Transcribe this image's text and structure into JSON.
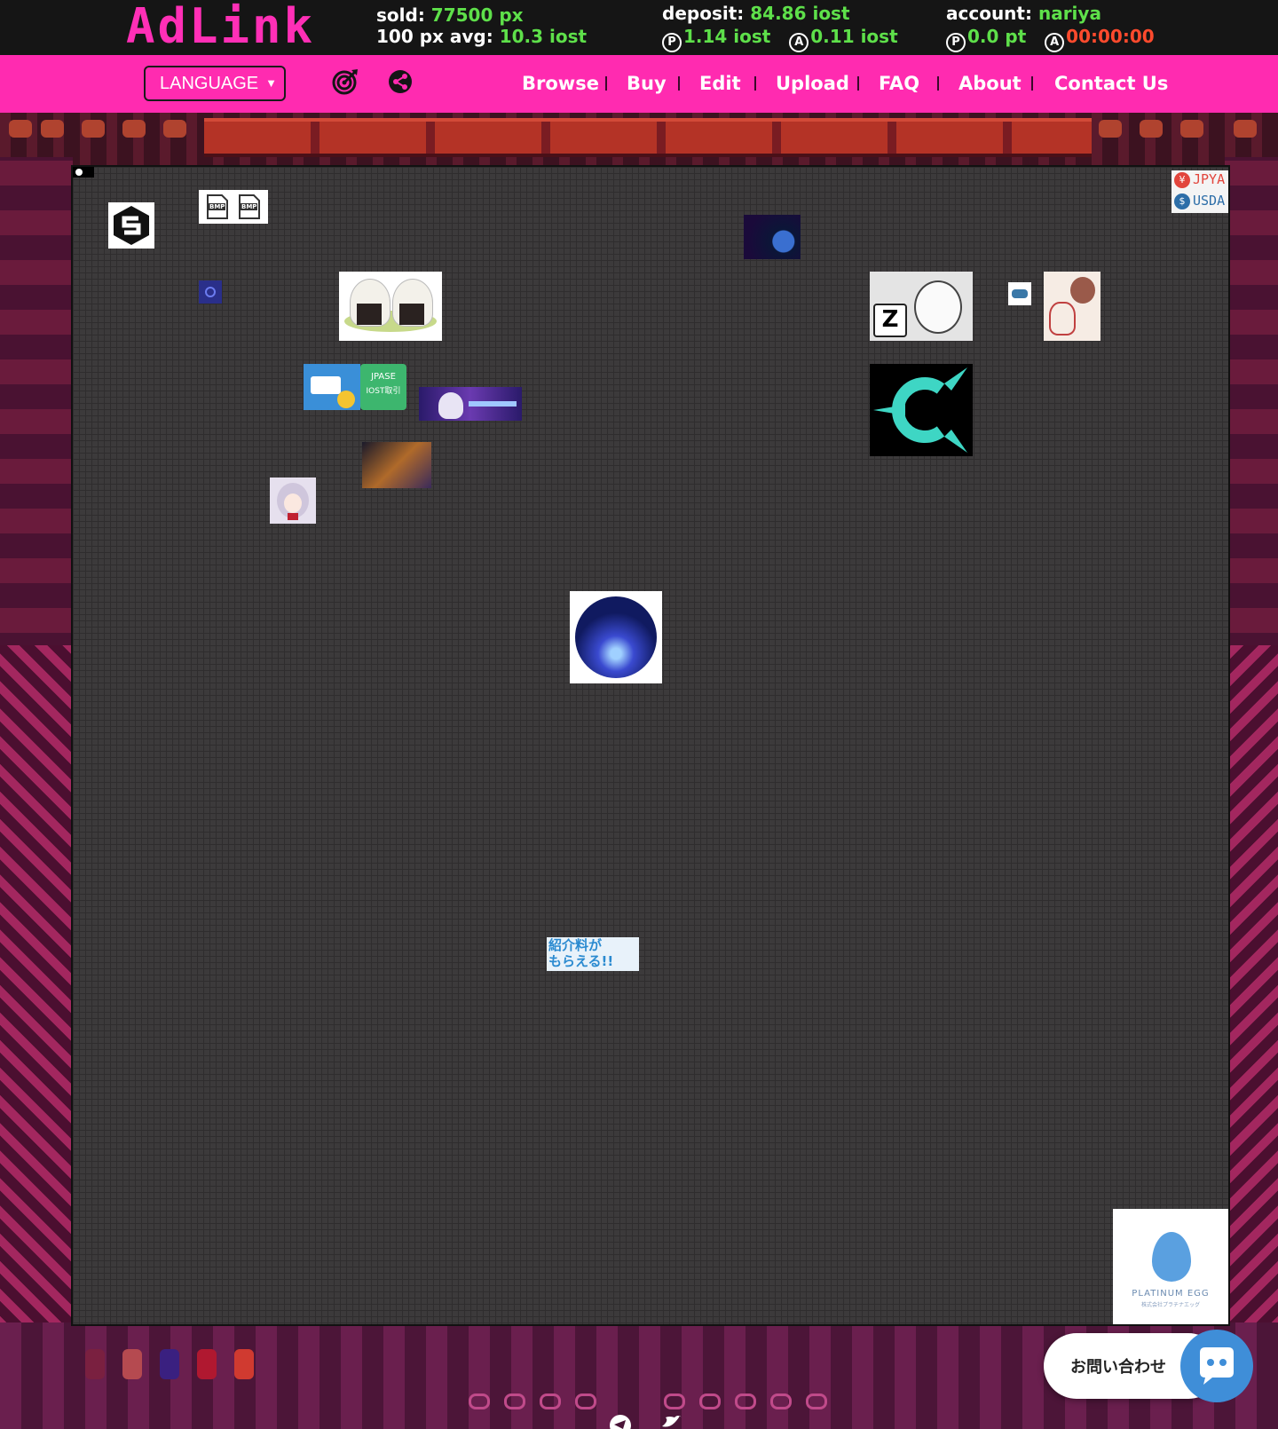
{
  "header": {
    "logo": "AdLink",
    "sold_label": "sold:",
    "sold_value": "77500 px",
    "avg_label": "100 px avg:",
    "avg_value": "10.3 iost",
    "deposit_label": "deposit:",
    "deposit_value": "84.86 iost",
    "deposit_p": "1.14 iost",
    "deposit_a": "0.11 iost",
    "account_label": "account:",
    "account_value": "nariya",
    "account_points": "0.0 pt",
    "account_timer": "00:00:00",
    "p_glyph": "P",
    "a_glyph": "A"
  },
  "nav": {
    "language": "LANGUAGE",
    "links": [
      "Browse",
      "Buy",
      "Edit",
      "Upload",
      "FAQ",
      "About",
      "Contact Us"
    ]
  },
  "ads": {
    "currency_jpya": "JPYA",
    "currency_usda": "USDA",
    "currency_yen": "¥",
    "currency_dollar": "$",
    "bmp_label": "BMP",
    "jpase_line1": "JPASE",
    "jpase_line2": "IOST取引",
    "referral_line1": "紹介料が",
    "referral_line2": "もらえる!!",
    "egg_title": "PLATINUM EGG",
    "egg_subtitle": "株式会社プラチナエッグ"
  },
  "chat": {
    "label": "お問い合わせ"
  },
  "colors": {
    "brand_pink": "#ff2bb0",
    "value_green": "#5ee04a",
    "timer_red": "#ff4a2d",
    "chat_blue": "#3f8ed8"
  },
  "icons": [
    "target-icon",
    "share-icon",
    "chat-icon",
    "telegram-icon",
    "twitter-icon"
  ]
}
